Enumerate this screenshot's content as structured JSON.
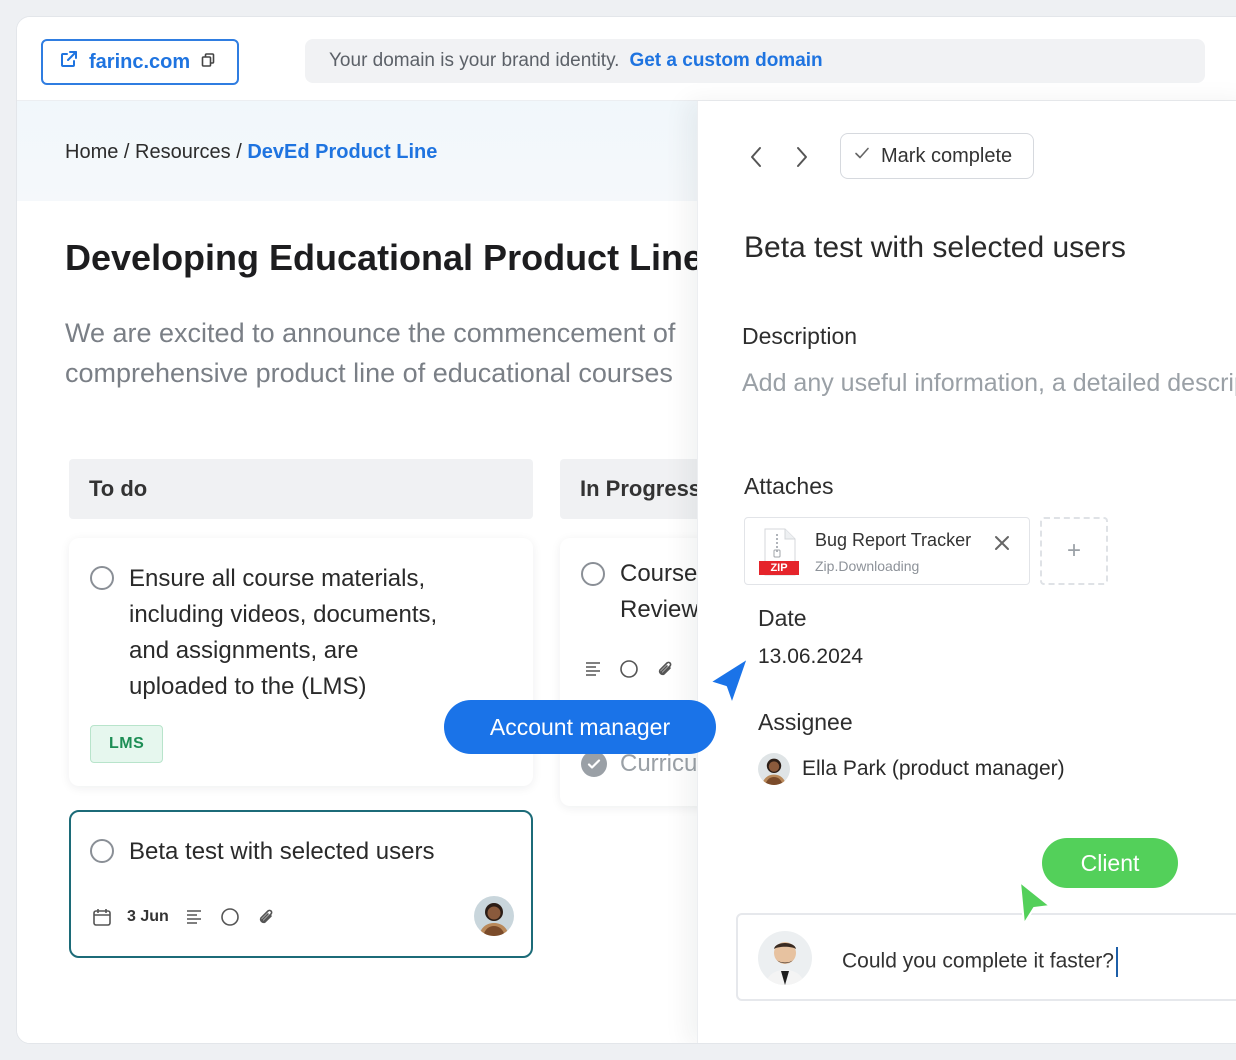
{
  "topbar": {
    "domain_label": "farinc.com",
    "banner_text": "Your domain is your brand identity.",
    "banner_link": "Get a custom domain"
  },
  "breadcrumb": {
    "home": "Home",
    "sep1": "/",
    "resources": "Resources",
    "sep2": "/",
    "current": "DevEd Product Line"
  },
  "page": {
    "title": "Developing Educational Product Line",
    "description_line1": "We are excited to announce the commencement of",
    "description_line2": "comprehensive product line of educational courses"
  },
  "board": {
    "columns": [
      {
        "title": "To do"
      },
      {
        "title": "In Progress"
      }
    ],
    "cards": [
      {
        "lines": [
          "Ensure all course materials,",
          "including videos, documents,",
          "and assignments, are",
          "uploaded to the (LMS)"
        ],
        "tag": "LMS"
      },
      {
        "title": "Beta test with selected users",
        "date": "3 Jun"
      },
      {
        "lines": [
          "Course Materials",
          "Review"
        ]
      },
      {
        "title": "Curriculum"
      }
    ]
  },
  "detail": {
    "mark_complete": "Mark complete",
    "title": "Beta test with selected users",
    "description_label": "Description",
    "description_placeholder": "Add any useful information, a detailed description",
    "attaches_label": "Attaches",
    "attachment": {
      "name": "Bug Report Tracker",
      "status": "Zip.Downloading",
      "type_badge": "ZIP"
    },
    "add_attachment": "+",
    "date_label": "Date",
    "date_value": "13.06.2024",
    "assignee_label": "Assignee",
    "assignee_name": "Ella Park (product manager)",
    "comment_text": "Could you complete it faster?"
  },
  "overlays": {
    "account_manager": "Account manager",
    "client": "Client"
  },
  "colors": {
    "brand_blue": "#1f74e0",
    "pill_blue": "#1a73e8",
    "pill_green": "#53d05a",
    "tag_green": "#1d8e55"
  }
}
